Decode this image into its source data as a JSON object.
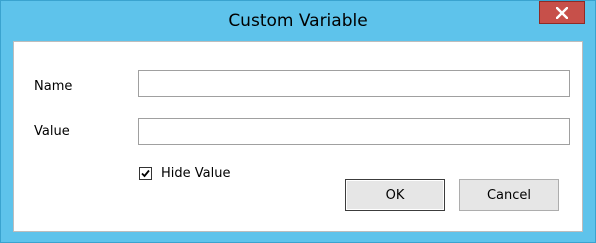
{
  "window": {
    "title": "Custom Variable",
    "close_icon": "close-icon"
  },
  "form": {
    "name_label": "Name",
    "name_value": "",
    "value_label": "Value",
    "value_value": "",
    "hide_value_label": "Hide Value",
    "hide_value_checked": true
  },
  "buttons": {
    "ok_label": "OK",
    "cancel_label": "Cancel"
  },
  "colors": {
    "frame": "#5ec3eb",
    "close_button": "#c7504a"
  }
}
